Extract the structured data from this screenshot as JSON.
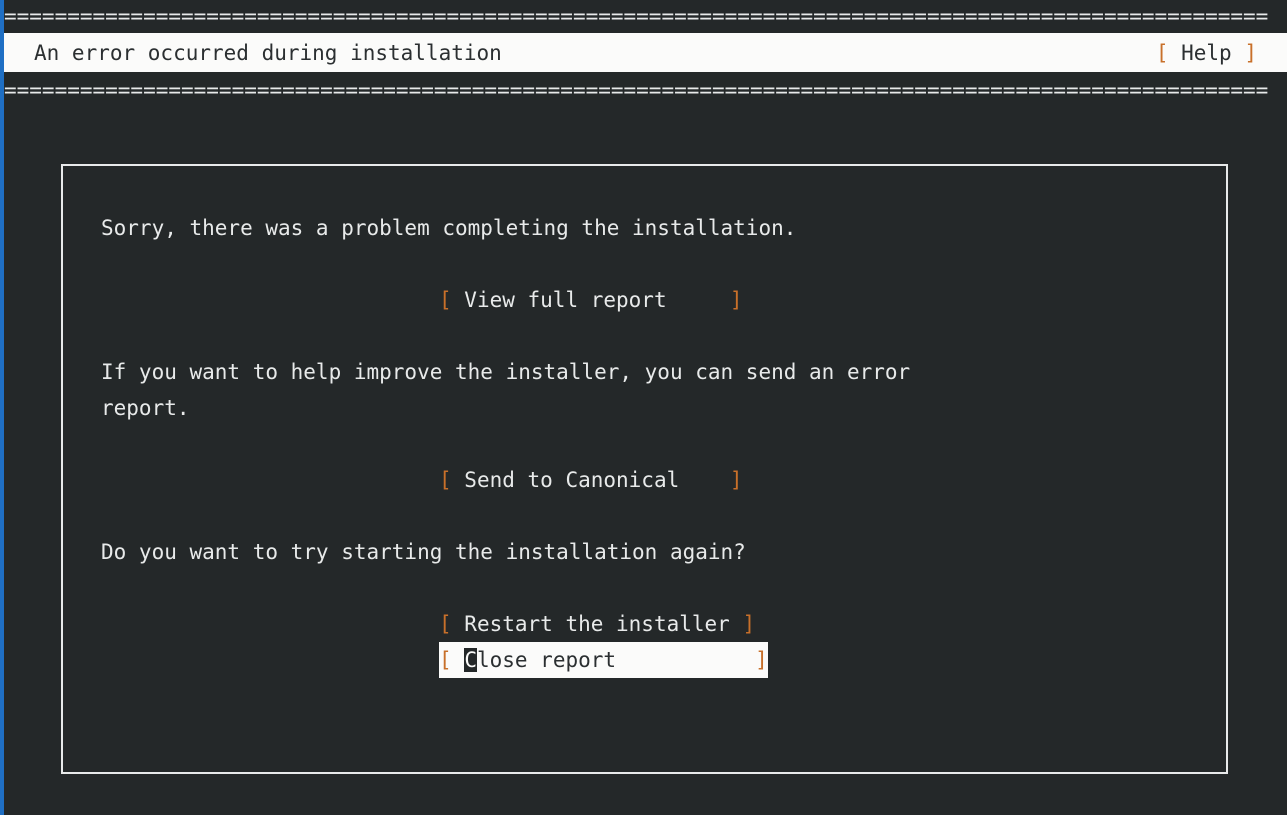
{
  "screen": {
    "background_color": "#242829",
    "foreground_color": "#e8eaea",
    "accent_bar_color": "#1f6fc4",
    "highlight_bg_color": "#fbfbfa",
    "highlight_fg_color": "#2b2f31",
    "bracket_color": "#c8702a"
  },
  "header": {
    "rule_top": "====================================================================================================",
    "rule_bottom": "====================================================================================================",
    "title": "An error occurred during installation",
    "help": {
      "open_bracket": "[",
      "label": " Help ",
      "close_bracket": "]"
    }
  },
  "dialog": {
    "paragraphs": {
      "intro": "Sorry, there was a problem completing the installation.",
      "report_offer": "If you want to help improve the installer, you can send an error\nreport.",
      "retry_question": "Do you want to try starting the installation again?"
    },
    "buttons": [
      {
        "id": "view-full-report",
        "open_bracket": "[",
        "label": " View full report     ",
        "close_bracket": "]",
        "focused": false
      },
      {
        "id": "send-to-canonical",
        "open_bracket": "[",
        "label": " Send to Canonical    ",
        "close_bracket": "]",
        "focused": false
      },
      {
        "id": "restart-the-installer",
        "open_bracket": "[",
        "label": " Restart the installer ",
        "close_bracket": "]",
        "focused": false
      },
      {
        "id": "close-report",
        "open_bracket": "[",
        "label_cursor": "C",
        "label_prefix": " ",
        "label_rest": "lose report           ",
        "close_bracket": "]",
        "focused": true
      }
    ]
  }
}
